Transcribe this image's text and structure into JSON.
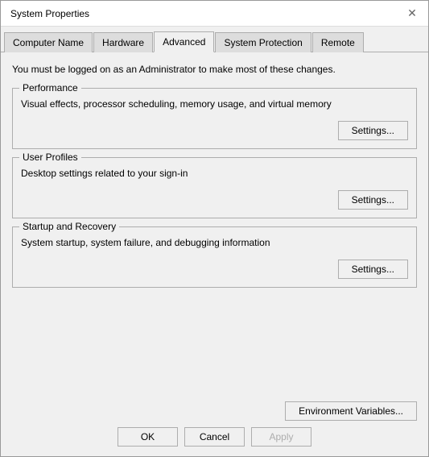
{
  "window": {
    "title": "System Properties"
  },
  "tabs": [
    {
      "label": "Computer Name",
      "active": false
    },
    {
      "label": "Hardware",
      "active": false
    },
    {
      "label": "Advanced",
      "active": true
    },
    {
      "label": "System Protection",
      "active": false
    },
    {
      "label": "Remote",
      "active": false
    }
  ],
  "admin_notice": "You must be logged on as an Administrator to make most of these changes.",
  "groups": [
    {
      "label": "Performance",
      "description": "Visual effects, processor scheduling, memory usage, and virtual memory",
      "settings_label": "Settings..."
    },
    {
      "label": "User Profiles",
      "description": "Desktop settings related to your sign-in",
      "settings_label": "Settings..."
    },
    {
      "label": "Startup and Recovery",
      "description": "System startup, system failure, and debugging information",
      "settings_label": "Settings..."
    }
  ],
  "footer": {
    "env_variables_label": "Environment Variables...",
    "ok_label": "OK",
    "cancel_label": "Cancel",
    "apply_label": "Apply"
  }
}
